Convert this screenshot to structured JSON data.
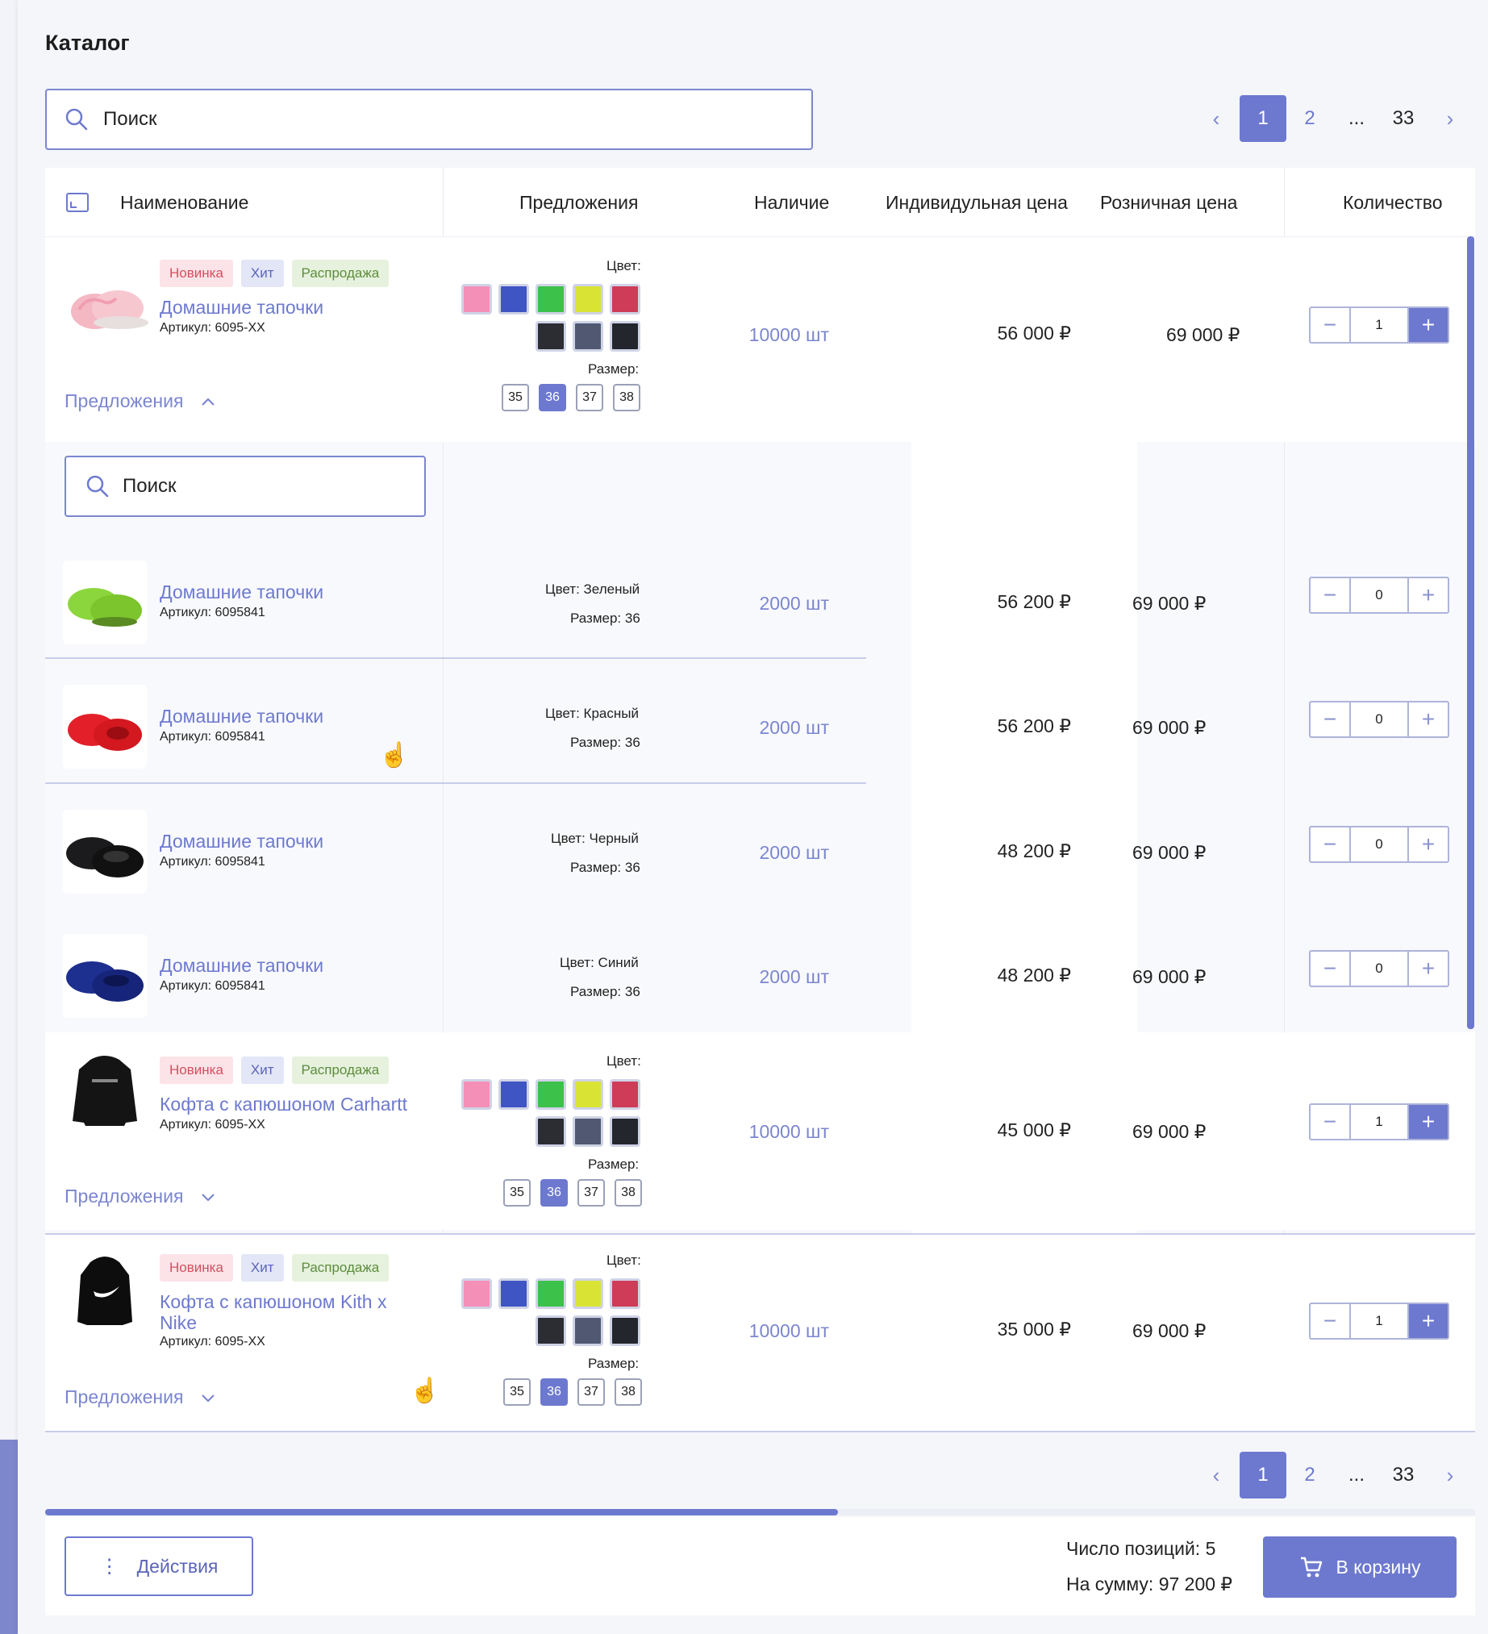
{
  "title": "Каталог",
  "search": {
    "placeholder": "Поиск"
  },
  "pagination": {
    "prev_icon": "chevron-left-icon",
    "pages": [
      "1",
      "2",
      "...",
      "33"
    ],
    "active": "1",
    "next_icon": "chevron-right-icon"
  },
  "table": {
    "columns": {
      "name": "Наименование",
      "offers": "Предложения",
      "stock": "Наличие",
      "individual_price": "Индивидульная цена",
      "retail_price": "Розничная цена",
      "quantity": "Количество"
    },
    "color_label": "Цвет:",
    "size_label": "Размер:",
    "offers_toggle": "Предложения",
    "tags": {
      "new": "Новинка",
      "hit": "Хит",
      "sale": "Распродажа"
    },
    "swatch_colors": [
      "#f48fb8",
      "#3f55c4",
      "#3cc24a",
      "#d9e334",
      "#cf3c57",
      "#2b2d33",
      "#505872",
      "#24262d"
    ],
    "sizes": [
      "35",
      "36",
      "37",
      "38"
    ],
    "selected_size": "36",
    "products": [
      {
        "name": "Домашние тапочки",
        "article": "Артикул: 6095-XX",
        "stock": "10000 шт",
        "individual_price": "56 000 ₽",
        "retail_price": "69 000 ₽",
        "qty": "1",
        "offers_expanded": true
      },
      {
        "name": "Кофта с капюшоном Carhartt",
        "article": "Артикул: 6095-XX",
        "stock": "10000 шт",
        "individual_price": "45 000 ₽",
        "retail_price": "69 000 ₽",
        "qty": "1",
        "offers_expanded": false
      },
      {
        "name": "Кофта с капюшоном Kith x Nike",
        "article": "Артикул: 6095-XX",
        "stock": "10000 шт",
        "individual_price": "35 000 ₽",
        "retail_price": "69 000 ₽",
        "qty": "1",
        "offers_expanded": false
      }
    ],
    "offer_search": {
      "placeholder": "Поиск"
    },
    "offers": [
      {
        "name": "Домашние тапочки",
        "article": "Артикул: 6095841",
        "color": "Цвет: Зеленый",
        "size": "Размер: 36",
        "stock": "2000 шт",
        "individual_price": "56 200 ₽",
        "retail_price": "69 000 ₽",
        "qty": "0"
      },
      {
        "name": "Домашние тапочки",
        "article": "Артикул: 6095841",
        "color": "Цвет: Красный",
        "size": "Размер: 36",
        "stock": "2000 шт",
        "individual_price": "56 200 ₽",
        "retail_price": "69 000 ₽",
        "qty": "0"
      },
      {
        "name": "Домашние тапочки",
        "article": "Артикул: 6095841",
        "color": "Цвет: Черный",
        "size": "Размер: 36",
        "stock": "2000 шт",
        "individual_price": "48 200 ₽",
        "retail_price": "69 000 ₽",
        "qty": "0"
      },
      {
        "name": "Домашние тапочки",
        "article": "Артикул: 6095841",
        "color": "Цвет: Синий",
        "size": "Размер: 36",
        "stock": "2000 шт",
        "individual_price": "48 200 ₽",
        "retail_price": "69 000 ₽",
        "qty": "0"
      }
    ]
  },
  "footer": {
    "actions_label": "Действия",
    "positions": "Число позиций: 5",
    "sum": "На сумму: 97 200 ₽",
    "cart_label": "В корзину"
  },
  "colors": {
    "accent": "#6d79cf",
    "link": "#7b86cf"
  }
}
